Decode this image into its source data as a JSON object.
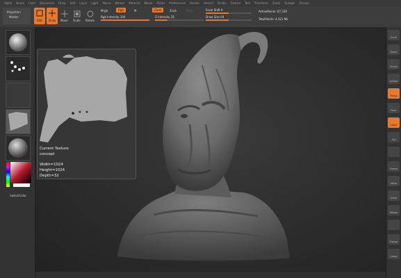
{
  "menu": [
    "Alpha",
    "Brush",
    "Color",
    "Document",
    "Draw",
    "Edit",
    "Layer",
    "Light",
    "Macro",
    "Marker",
    "Material",
    "Movie",
    "Picker",
    "Preferences",
    "Render",
    "Stencil",
    "Stroke",
    "Texture",
    "Tool",
    "Transform",
    "Zoom",
    "Zplugin",
    "Zscript"
  ],
  "toolbar": {
    "projection_master_line1": "Projection",
    "projection_master_line2": "Master",
    "edit": "Edit",
    "draw": "Draw",
    "move": "Move",
    "scale": "Scale",
    "rotate": "Rotate",
    "mrgb": "Mrgb",
    "rgb": "Rgb",
    "m": "M",
    "rgb_intensity": "Rgb Intensity 100",
    "zadd": "Zadd",
    "zsub": "Zsub",
    "zcut": "Zcut",
    "z_intensity": "Z Intensity 25",
    "focal_shift": "Focal Shift 0",
    "draw_size": "Draw Size 64",
    "active_points": "ActivePoints: 67,330",
    "total_points": "TotalPoints: 4,321 Mil"
  },
  "progress": {
    "rgb_intensity": 1.0,
    "z_intensity": 0.25,
    "focal_shift": 0.5,
    "draw_size": 0.5
  },
  "popup": {
    "title": "Current Texture",
    "name": "concept",
    "width": "Width=1024",
    "height": "Height=1024",
    "depth": "Depth=32"
  },
  "left": {
    "switch_color": "SwitchColor"
  },
  "right_buttons": [
    "Scroll",
    "Zoom",
    "Actual",
    "AAHalf",
    "Persp",
    "Floor",
    "Local",
    "Xyz",
    "",
    "Frame",
    "Move",
    "Scale",
    "Rotate",
    "",
    "Transp",
    "Lasso"
  ],
  "colors": {
    "accent": "#e8782b",
    "panel": "#333333",
    "viewport": "#2c2c2c"
  }
}
